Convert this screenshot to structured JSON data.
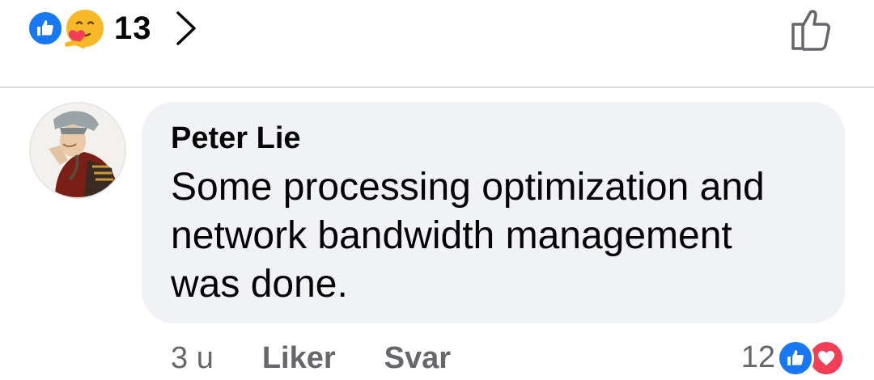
{
  "post_reactions": {
    "count": "13",
    "types": [
      "like-icon",
      "care-icon",
      "chevron-right-icon"
    ],
    "colors": {
      "like": "#1877f2",
      "care_face": "#f7b928",
      "care_heart": "#f33e58"
    }
  },
  "like_button": {
    "icon": "thumbs-up-outline-icon"
  },
  "comment": {
    "author": "Peter Lie",
    "text": "Some processing optimization and\nnetwork bandwidth management\nwas done.",
    "timestamp": "3 u",
    "like_label": "Liker",
    "reply_label": "Svar",
    "reaction_count": "12",
    "reaction_types": [
      "like-icon",
      "love-icon"
    ],
    "colors": {
      "bubble": "#f0f2f5",
      "secondary_text": "#65676b",
      "love": "#f33e58"
    }
  }
}
